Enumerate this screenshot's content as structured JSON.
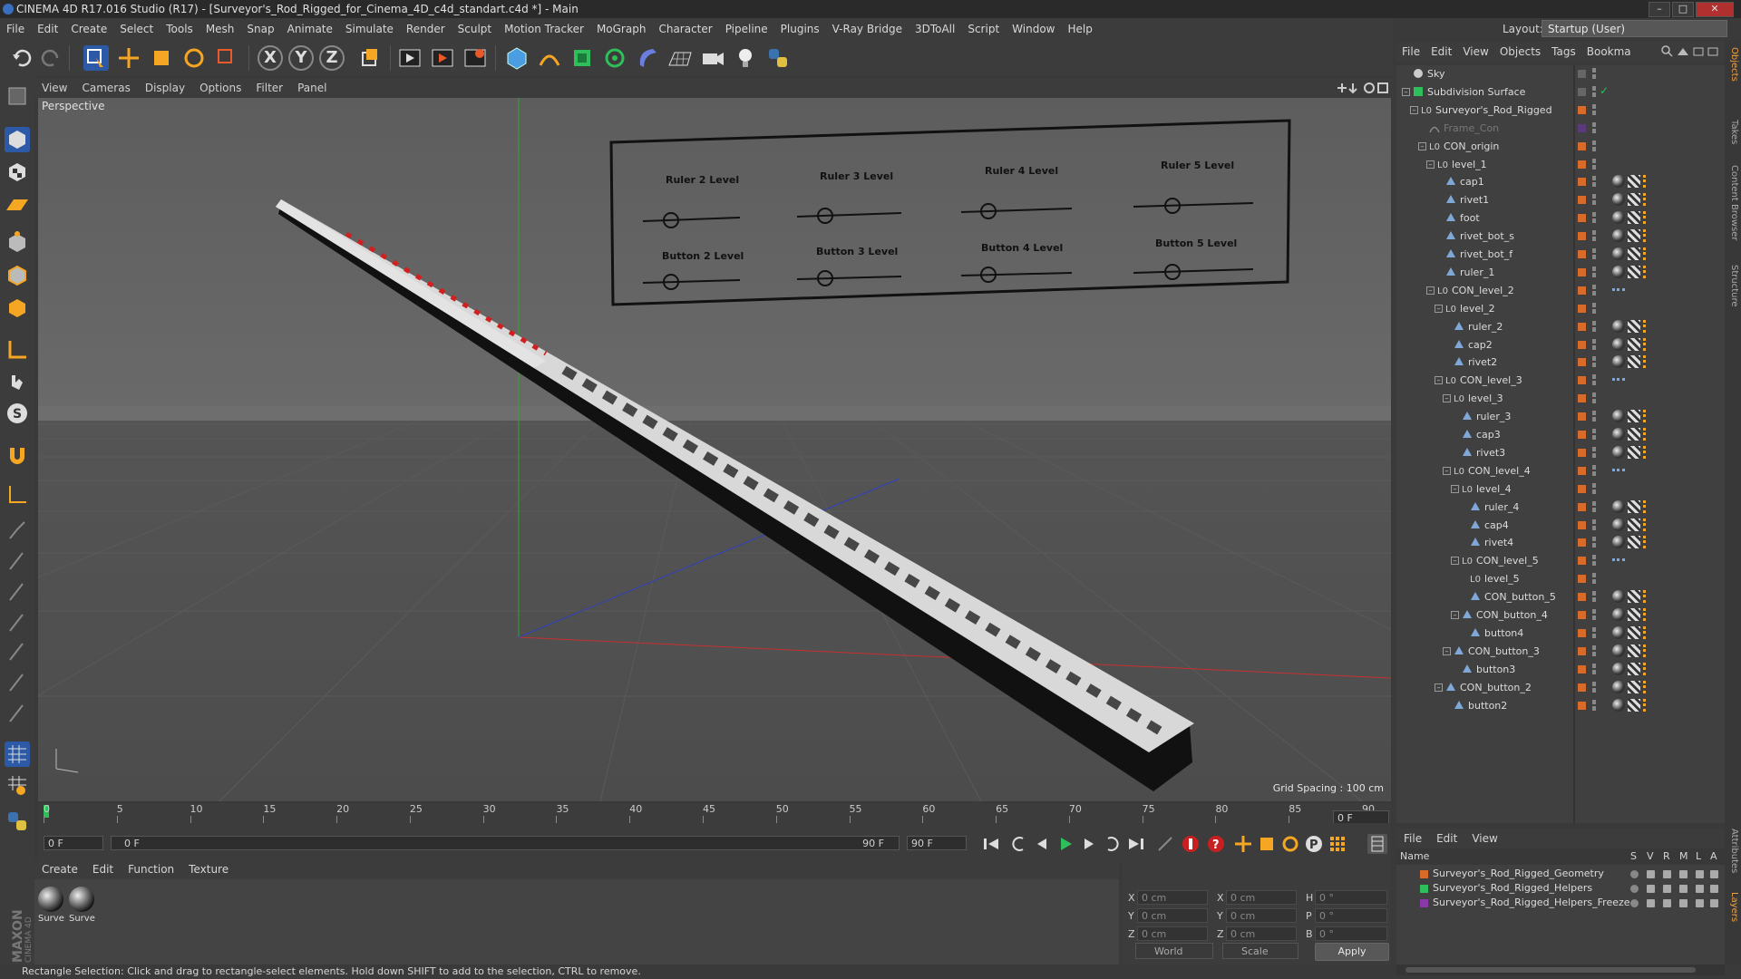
{
  "window": {
    "title": "CINEMA 4D R17.016 Studio (R17) - [Surveyor's_Rod_Rigged_for_Cinema_4D_c4d_standart.c4d *] - Main",
    "btn_min": "–",
    "btn_max": "□",
    "btn_close": "✕"
  },
  "menubar": [
    "File",
    "Edit",
    "Create",
    "Select",
    "Tools",
    "Mesh",
    "Snap",
    "Animate",
    "Simulate",
    "Render",
    "Sculpt",
    "Motion Tracker",
    "MoGraph",
    "Character",
    "Pipeline",
    "Plugins",
    "V-Ray Bridge",
    "3DToAll",
    "Script",
    "Window",
    "Help"
  ],
  "layout": {
    "label": "Layout:",
    "value": "Startup (User)"
  },
  "toolbar": {
    "x": "X",
    "y": "Y",
    "z": "Z"
  },
  "viewport": {
    "menu": [
      "View",
      "Cameras",
      "Display",
      "Options",
      "Filter",
      "Panel"
    ],
    "camera": "Perspective",
    "grid_spacing": "Grid Spacing : 100 cm",
    "sliders": {
      "top": [
        "Ruler 2 Level",
        "Ruler 3 Level",
        "Ruler 4 Level",
        "Ruler 5 Level"
      ],
      "bottom": [
        "Button 2 Level",
        "Button 3 Level",
        "Button 4 Level",
        "Button 5 Level"
      ]
    }
  },
  "timeline": {
    "ticks": [
      "0",
      "5",
      "10",
      "15",
      "20",
      "25",
      "30",
      "35",
      "40",
      "45",
      "50",
      "55",
      "60",
      "65",
      "70",
      "75",
      "80",
      "85",
      "90"
    ],
    "current": "0 F",
    "start": "0 F",
    "range_start": "0 F",
    "range_end": "90 F",
    "end": "90 F"
  },
  "materials": {
    "menu": [
      "Create",
      "Edit",
      "Function",
      "Texture"
    ],
    "items": [
      "Surve",
      "Surve"
    ]
  },
  "coords": {
    "rows": [
      {
        "a": "X",
        "av": "0 cm",
        "b": "X",
        "bv": "0 cm",
        "c": "H",
        "cv": "0 °"
      },
      {
        "a": "Y",
        "av": "0 cm",
        "b": "Y",
        "bv": "0 cm",
        "c": "P",
        "cv": "0 °"
      },
      {
        "a": "Z",
        "av": "0 cm",
        "b": "Z",
        "bv": "0 cm",
        "c": "B",
        "cv": "0 °"
      }
    ],
    "mode1": "World",
    "mode2": "Scale",
    "apply": "Apply"
  },
  "status": "Rectangle Selection: Click and drag to rectangle-select elements. Hold down SHIFT to add to the selection, CTRL to remove.",
  "object_manager": {
    "menu": [
      "File",
      "Edit",
      "View",
      "Objects",
      "Tags",
      "Bookma"
    ],
    "objects": [
      {
        "name": "Sky",
        "depth": 0,
        "icon": "sky"
      },
      {
        "name": "Subdivision Surface",
        "depth": 0,
        "icon": "subd"
      },
      {
        "name": "Surveyor's_Rod_Rigged",
        "depth": 1,
        "icon": "null"
      },
      {
        "name": "Frame_Con",
        "depth": 2,
        "icon": "spline",
        "dim": true
      },
      {
        "name": "CON_origin",
        "depth": 2,
        "icon": "null"
      },
      {
        "name": "level_1",
        "depth": 3,
        "icon": "null"
      },
      {
        "name": "cap1",
        "depth": 4,
        "icon": "poly"
      },
      {
        "name": "rivet1",
        "depth": 4,
        "icon": "poly"
      },
      {
        "name": "foot",
        "depth": 4,
        "icon": "poly"
      },
      {
        "name": "rivet_bot_s",
        "depth": 4,
        "icon": "poly"
      },
      {
        "name": "rivet_bot_f",
        "depth": 4,
        "icon": "poly"
      },
      {
        "name": "ruler_1",
        "depth": 4,
        "icon": "poly"
      },
      {
        "name": "CON_level_2",
        "depth": 3,
        "icon": "null"
      },
      {
        "name": "level_2",
        "depth": 4,
        "icon": "null"
      },
      {
        "name": "ruler_2",
        "depth": 5,
        "icon": "poly"
      },
      {
        "name": "cap2",
        "depth": 5,
        "icon": "poly"
      },
      {
        "name": "rivet2",
        "depth": 5,
        "icon": "poly"
      },
      {
        "name": "CON_level_3",
        "depth": 4,
        "icon": "null"
      },
      {
        "name": "level_3",
        "depth": 5,
        "icon": "null"
      },
      {
        "name": "ruler_3",
        "depth": 6,
        "icon": "poly"
      },
      {
        "name": "cap3",
        "depth": 6,
        "icon": "poly"
      },
      {
        "name": "rivet3",
        "depth": 6,
        "icon": "poly"
      },
      {
        "name": "CON_level_4",
        "depth": 5,
        "icon": "null"
      },
      {
        "name": "level_4",
        "depth": 6,
        "icon": "null"
      },
      {
        "name": "ruler_4",
        "depth": 7,
        "icon": "poly"
      },
      {
        "name": "cap4",
        "depth": 7,
        "icon": "poly"
      },
      {
        "name": "rivet4",
        "depth": 7,
        "icon": "poly"
      },
      {
        "name": "CON_level_5",
        "depth": 6,
        "icon": "null"
      },
      {
        "name": "level_5",
        "depth": 7,
        "icon": "null"
      },
      {
        "name": "CON_button_5",
        "depth": 7,
        "icon": "poly"
      },
      {
        "name": "CON_button_4",
        "depth": 6,
        "icon": "poly"
      },
      {
        "name": "button4",
        "depth": 7,
        "icon": "poly"
      },
      {
        "name": "CON_button_3",
        "depth": 5,
        "icon": "poly"
      },
      {
        "name": "button3",
        "depth": 6,
        "icon": "poly"
      },
      {
        "name": "CON_button_2",
        "depth": 4,
        "icon": "poly"
      },
      {
        "name": "button2",
        "depth": 5,
        "icon": "poly"
      }
    ]
  },
  "right_tabs": [
    "Objects",
    "Takes",
    "Content Browser",
    "Structure"
  ],
  "right_tabs_lower": [
    "Attributes",
    "Layers"
  ],
  "layer_manager": {
    "menu": [
      "File",
      "Edit",
      "View"
    ],
    "columns": {
      "name": "Name",
      "s": "S",
      "v": "V",
      "r": "R",
      "m": "M",
      "l": "L",
      "a": "A"
    },
    "layers": [
      {
        "name": "Surveyor's_Rod_Rigged_Geometry",
        "color": "#d86a2a"
      },
      {
        "name": "Surveyor's_Rod_Rigged_Helpers",
        "color": "#2fbf5a"
      },
      {
        "name": "Surveyor's_Rod_Rigged_Helpers_Freeze",
        "color": "#8a3aa8"
      }
    ]
  },
  "maxon_logo": "MAXON CINEMA 4D"
}
